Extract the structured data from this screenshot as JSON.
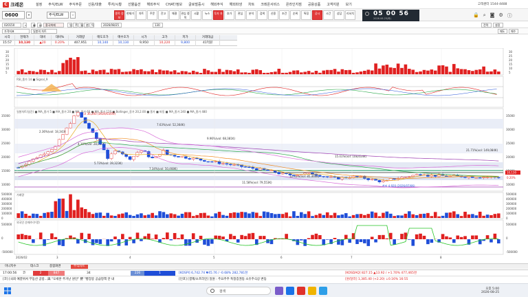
{
  "app": {
    "brand": "크레온",
    "menu": [
      "설정",
      "주식/ELW",
      "주식주문",
      "신용/대출",
      "투자/시황",
      "선물옵션",
      "해외주식",
      "CHAT/정보",
      "글로벌증시",
      "해외주식",
      "해외파생",
      "차트",
      "크레온서비스",
      "온라인지점",
      "공용상품",
      "고객지원",
      "보기"
    ],
    "callcenter": "고객센터 1544-4488"
  },
  "toolbar": {
    "code": "0600",
    "stock_tag": "주식/ELW",
    "buttons": [
      "종목\n정보",
      "현재가",
      "차트",
      "주문",
      "잔고",
      "체결",
      "관심\n종목",
      "시황",
      "뉴스",
      "투자\n자",
      "호가",
      "관심",
      "분석",
      "검색",
      "신용",
      "조건",
      "순위",
      "특징",
      "공시",
      "시간",
      "상담",
      "리서치"
    ],
    "clock_time": "05 00 56",
    "clock_date": "2026.08.25(화)"
  },
  "options": {
    "code_field": "020150",
    "symbol": "흥국화재",
    "period_tabs": [
      "일",
      "주",
      "월",
      "분",
      "틱"
    ],
    "date": "2026/08/25",
    "count": "130",
    "right_buttons": [
      "전략",
      "설정"
    ],
    "second_row": [
      "가격지표",
      "일봉의 차트"
    ],
    "right_label": "매도",
    "right_label2": "매수"
  },
  "price_table": {
    "headers": [
      "시각",
      "현재가",
      "대비",
      "대비%",
      "거래량",
      "매도호가",
      "매수호가",
      "시가",
      "고가",
      "저가",
      "거래대금"
    ],
    "values": [
      "15:57",
      "10,130",
      "▲20",
      "0.20%",
      "407,951",
      "10,140",
      "10,130",
      "9,950",
      "10,220",
      "9,800",
      "41억원"
    ]
  },
  "chart_labels": {
    "top_price": "최고 36,200 (2026/03/05)",
    "low_price": "최저 4,920 (2026/07/06)",
    "fib": [
      "2.36%(vol: 18,343K)",
      "7.63%(vol: 52,364K)",
      "9.96%(vol: 68,381K)",
      "21.71%(vol: 149,084K)",
      "15.01%(vol: 108,614K)",
      "5.73%(vol: 39,323K)",
      "7.34%(vol: 50,468K)",
      "11.58%(vol: 79,553K)",
      "12.45%(vol: 85,464K)",
      "4.10%(vol: 28,000K)"
    ],
    "rsi_title": "RSI_종가 14 ■ Signal_9",
    "vol_title": "거래량",
    "obv_title": "외국인 순매수(수량)",
    "main_title": "일봉차트(일간) ■ MA_종가 5 ■ MA_종가 20 ■ MA_종가 60 ■ MA_종가 120 ■ Bollinger_종가 20,2.00 ■ 종가 ■ 파동 ■ MA_종가 240 ■ MA_종가 480",
    "x_ticks": [
      "2026/02",
      "3",
      "4",
      "5",
      "6",
      "7",
      "8"
    ],
    "y_main": [
      "35000",
      "30000",
      "25000",
      "20000",
      "15000",
      "10000"
    ],
    "y_vol": [
      "500000",
      "400000",
      "300000",
      "200000",
      "100000",
      "0"
    ],
    "y_obv": [
      "500000",
      "0",
      "-500000"
    ],
    "y_top": [
      "30",
      "25",
      "20",
      "15",
      "10",
      "5"
    ],
    "cur_badge": "10,130",
    "pct_badge": "0.20%"
  },
  "tabs": [
    "미니지수",
    "데스크",
    "종합화면",
    "주식차트"
  ],
  "status": {
    "time1": "17:00:56",
    "t1": "코",
    "n1": "2",
    "n2": "847",
    "n3": "34",
    "n4": "226",
    "n5": "1",
    "kospi": "[KOSPI] 6,742.74 ▼45.76 / -0.68% 282,781천",
    "kosdaq": "[KOSDAQ] 827.15 ▲13.92 / +1.70% 477,465천",
    "news1": "[코] [국회 예결위서 부동산 공방…與 \"오세훈 주거난 원인\" 野 \"빵장봉 공급정책 만 내",
    "news2": "[인포] [결제/소프라인] 일원 : 주요주주 특정증권등 소유주식상 변동",
    "usd": "[원/달러] 1,385.40 (+2.20) ↓0.16% 16:55"
  },
  "taskbar": {
    "search_placeholder": "검색",
    "time": "오후 5:00",
    "date": "2026-08-25"
  }
}
